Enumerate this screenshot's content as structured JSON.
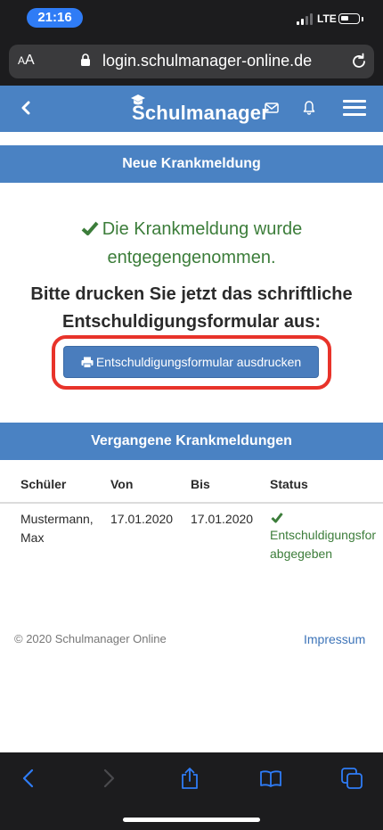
{
  "status_bar": {
    "time": "21:16",
    "network": "LTE"
  },
  "browser": {
    "aa_small": "A",
    "aa_large": "A",
    "url": "login.schulmanager-online.de"
  },
  "header": {
    "logo_text": "Schulmanager"
  },
  "new_report": {
    "title": "Neue Krankmeldung",
    "success_message": "Die Krankmeldung wurde entgegengenommen.",
    "instruction": "Bitte drucken Sie jetzt das schriftliche Entschuldigungsformular aus:",
    "print_button_label": "Entschuldigungsformular ausdrucken"
  },
  "past_reports": {
    "title": "Vergangene Krankmeldungen",
    "columns": [
      "Schüler",
      "Von",
      "Bis",
      "Status"
    ],
    "rows": [
      {
        "student_line1": "Mustermann,",
        "student_line2": "Max",
        "from": "17.01.2020",
        "to": "17.01.2020",
        "status_line1": "Entschuldigungsfor",
        "status_line2": "abgegeben"
      }
    ]
  },
  "footer": {
    "copyright": "© 2020 Schulmanager Online",
    "imprint_link": "Impressum"
  },
  "colors": {
    "accent_blue": "#4a82c3",
    "success_green": "#3c7d3a",
    "highlight_red": "#e8332a",
    "toolbar_blue": "#2f7cf6"
  }
}
